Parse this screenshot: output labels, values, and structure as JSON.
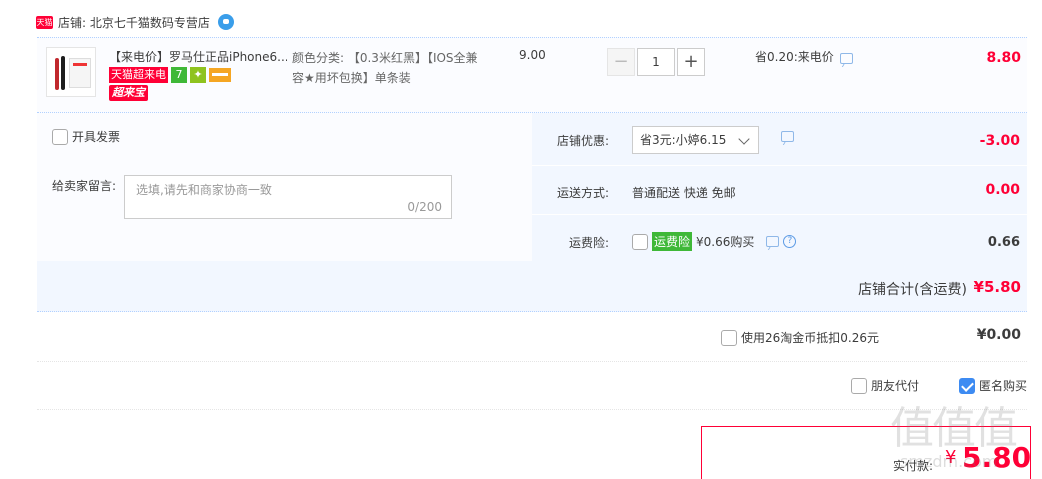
{
  "shop": {
    "badge": "天猫",
    "name": "店铺: 北京七千猫数码专营店"
  },
  "product": {
    "title": "【来电价】罗马仕正品iPhone6...",
    "tags": {
      "tmall_flash": "天猫超来电",
      "seven_day": "7",
      "chao": "超来宝"
    },
    "sku": "颜色分类: 【0.3米红黑】【IOS全兼容★用坏包换】单条装",
    "unit_price": "9.00",
    "quantity": "1",
    "qty_minus": "−",
    "qty_plus": "+",
    "discount": "省0.20:来电价",
    "subtotal": "8.80"
  },
  "options": {
    "invoice_label": "开具发票",
    "note_label": "给卖家留言:",
    "note_placeholder": "选填,请先和商家协商一致",
    "note_count": "0/200",
    "shop_discount_label": "店铺优惠:",
    "shop_discount_value": "省3元:小婷6.15",
    "shop_discount_amount": "-3.00",
    "shipping_label": "运送方式:",
    "shipping_value": "普通配送 快递 免邮",
    "shipping_amount": "0.00",
    "insurance_label": "运费险:",
    "insurance_tag": "运费险",
    "insurance_value": "¥0.66购买",
    "insurance_amount": "0.66"
  },
  "totals": {
    "shop_total_label": "店铺合计(含运费)",
    "shop_total_value": "¥5.80",
    "coin_label": "使用26淘金币抵扣0.26元",
    "coin_value": "¥0.00",
    "friend_pay_label": "朋友代付",
    "anonymous_label": "匿名购买",
    "pay_label": "实付款:",
    "pay_currency": "¥",
    "pay_value": "5.80"
  },
  "watermark": {
    "logo": "值值值",
    "site": "smzdm.com"
  },
  "colors": {
    "accent_red": "#ff0036",
    "row_bg": "#f2f7ff",
    "link_blue": "#3d8bf2"
  }
}
